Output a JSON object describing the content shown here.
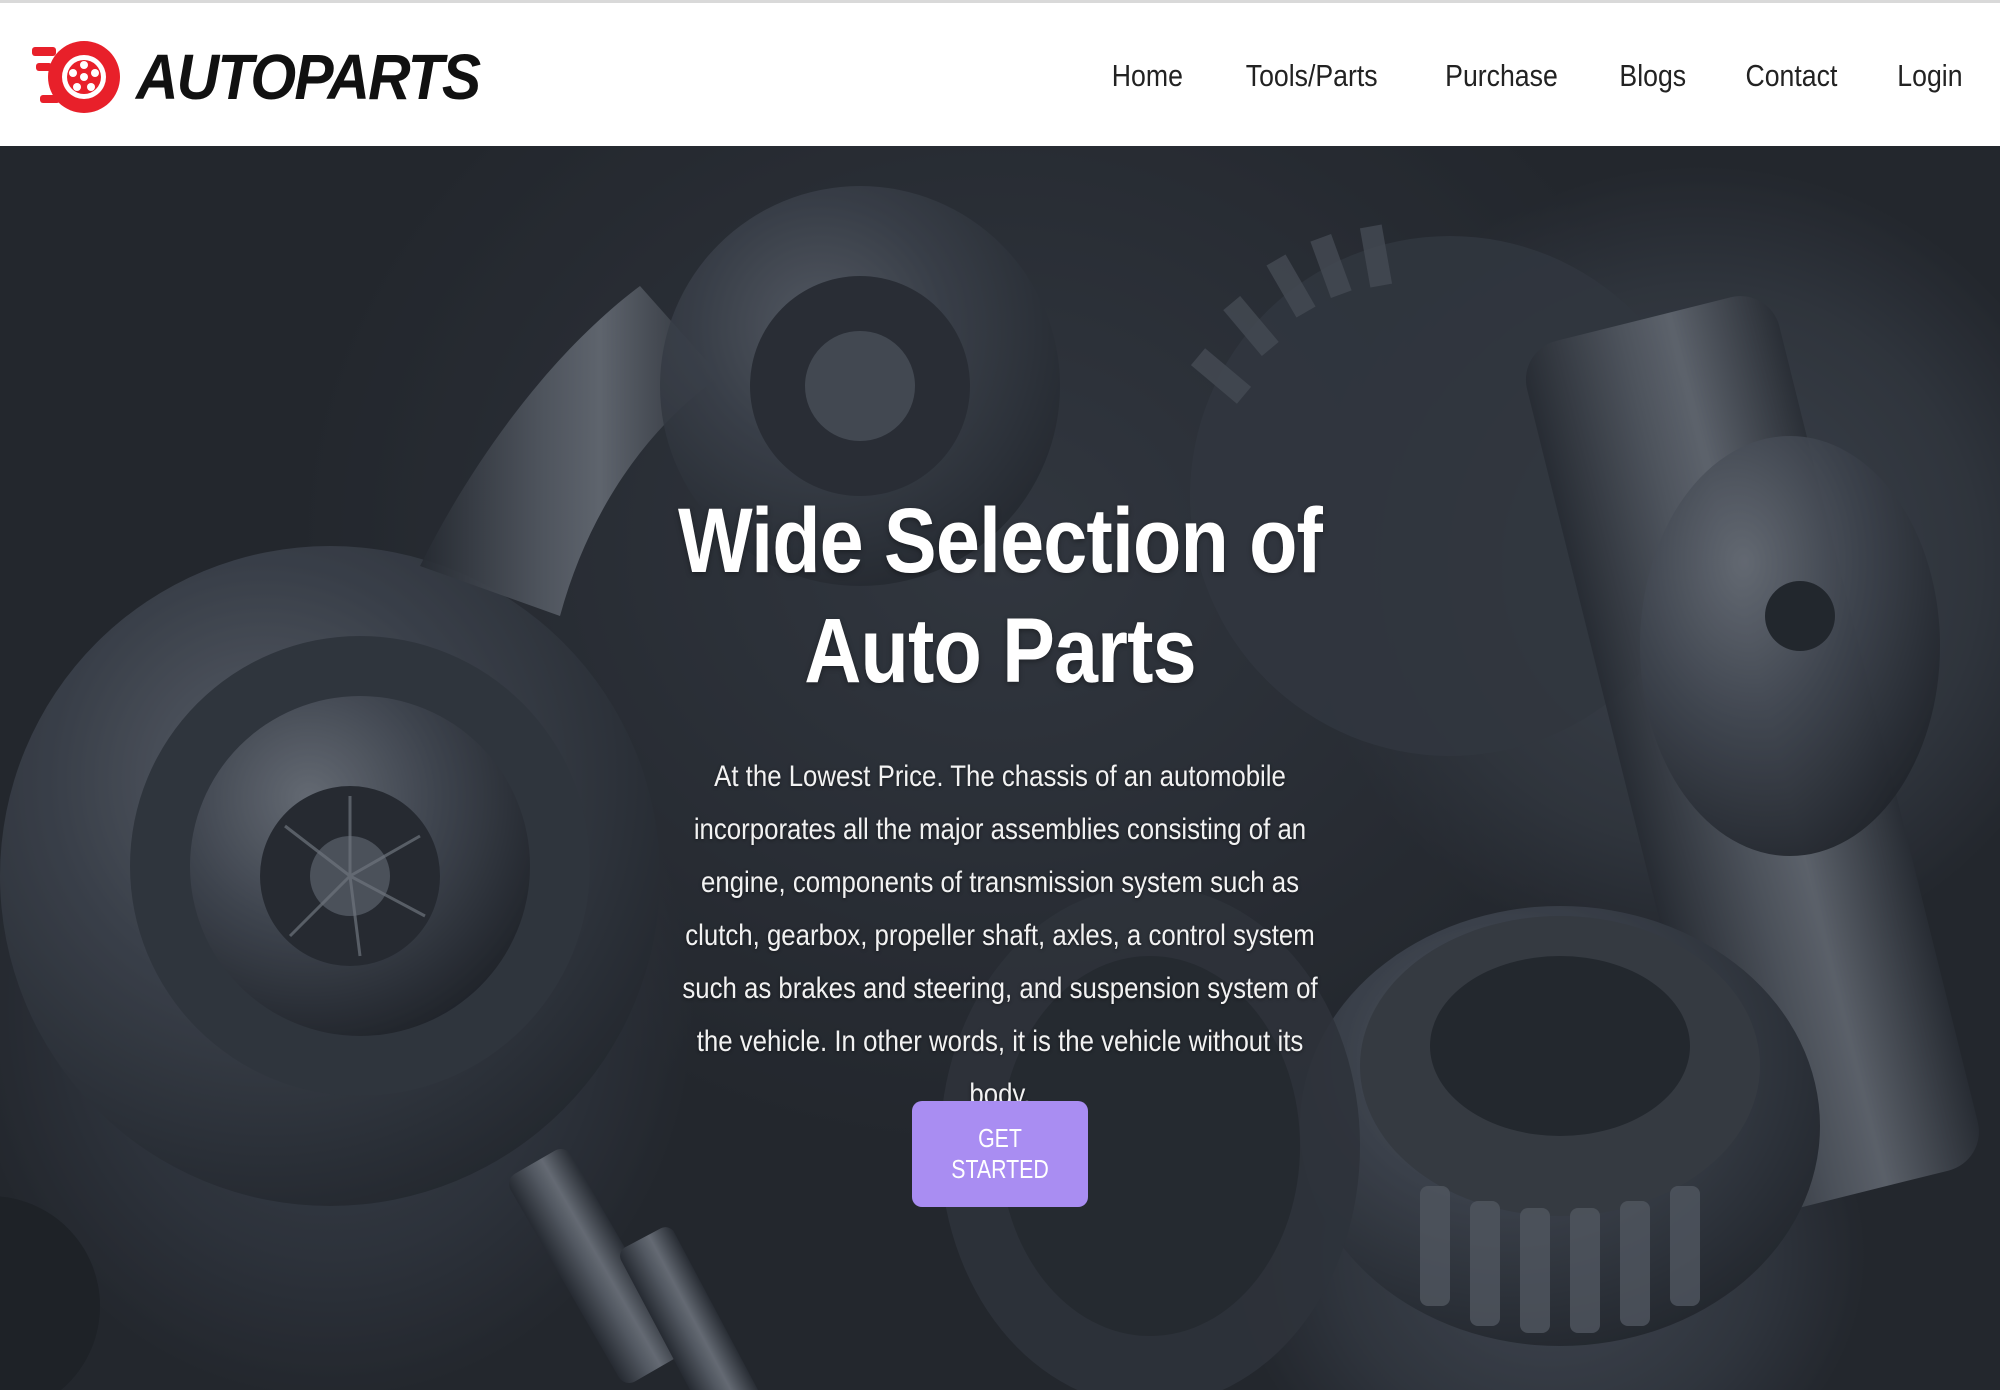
{
  "brand": {
    "name": "AUTOPARTS",
    "logo_icon": "wheel-logo-icon",
    "logo_color": "#e8202a"
  },
  "nav": {
    "items": [
      {
        "label": "Home"
      },
      {
        "label": "Tools/Parts"
      },
      {
        "label": "Purchase"
      },
      {
        "label": "Blogs"
      },
      {
        "label": "Contact"
      },
      {
        "label": "Login"
      }
    ]
  },
  "hero": {
    "title_line1": "Wide Selection of",
    "title_line2": "Auto Parts",
    "description": "At the Lowest Price. The chassis of an automobile incorporates all the major assemblies consisting of an engine, components of transmission system such as clutch, gearbox, propeller shaft, axles, a control system such as brakes and steering, and suspension system of the vehicle. In other words, it is the vehicle without its body.",
    "cta_label": "GET STARTED",
    "cta_color": "#a98df2"
  }
}
